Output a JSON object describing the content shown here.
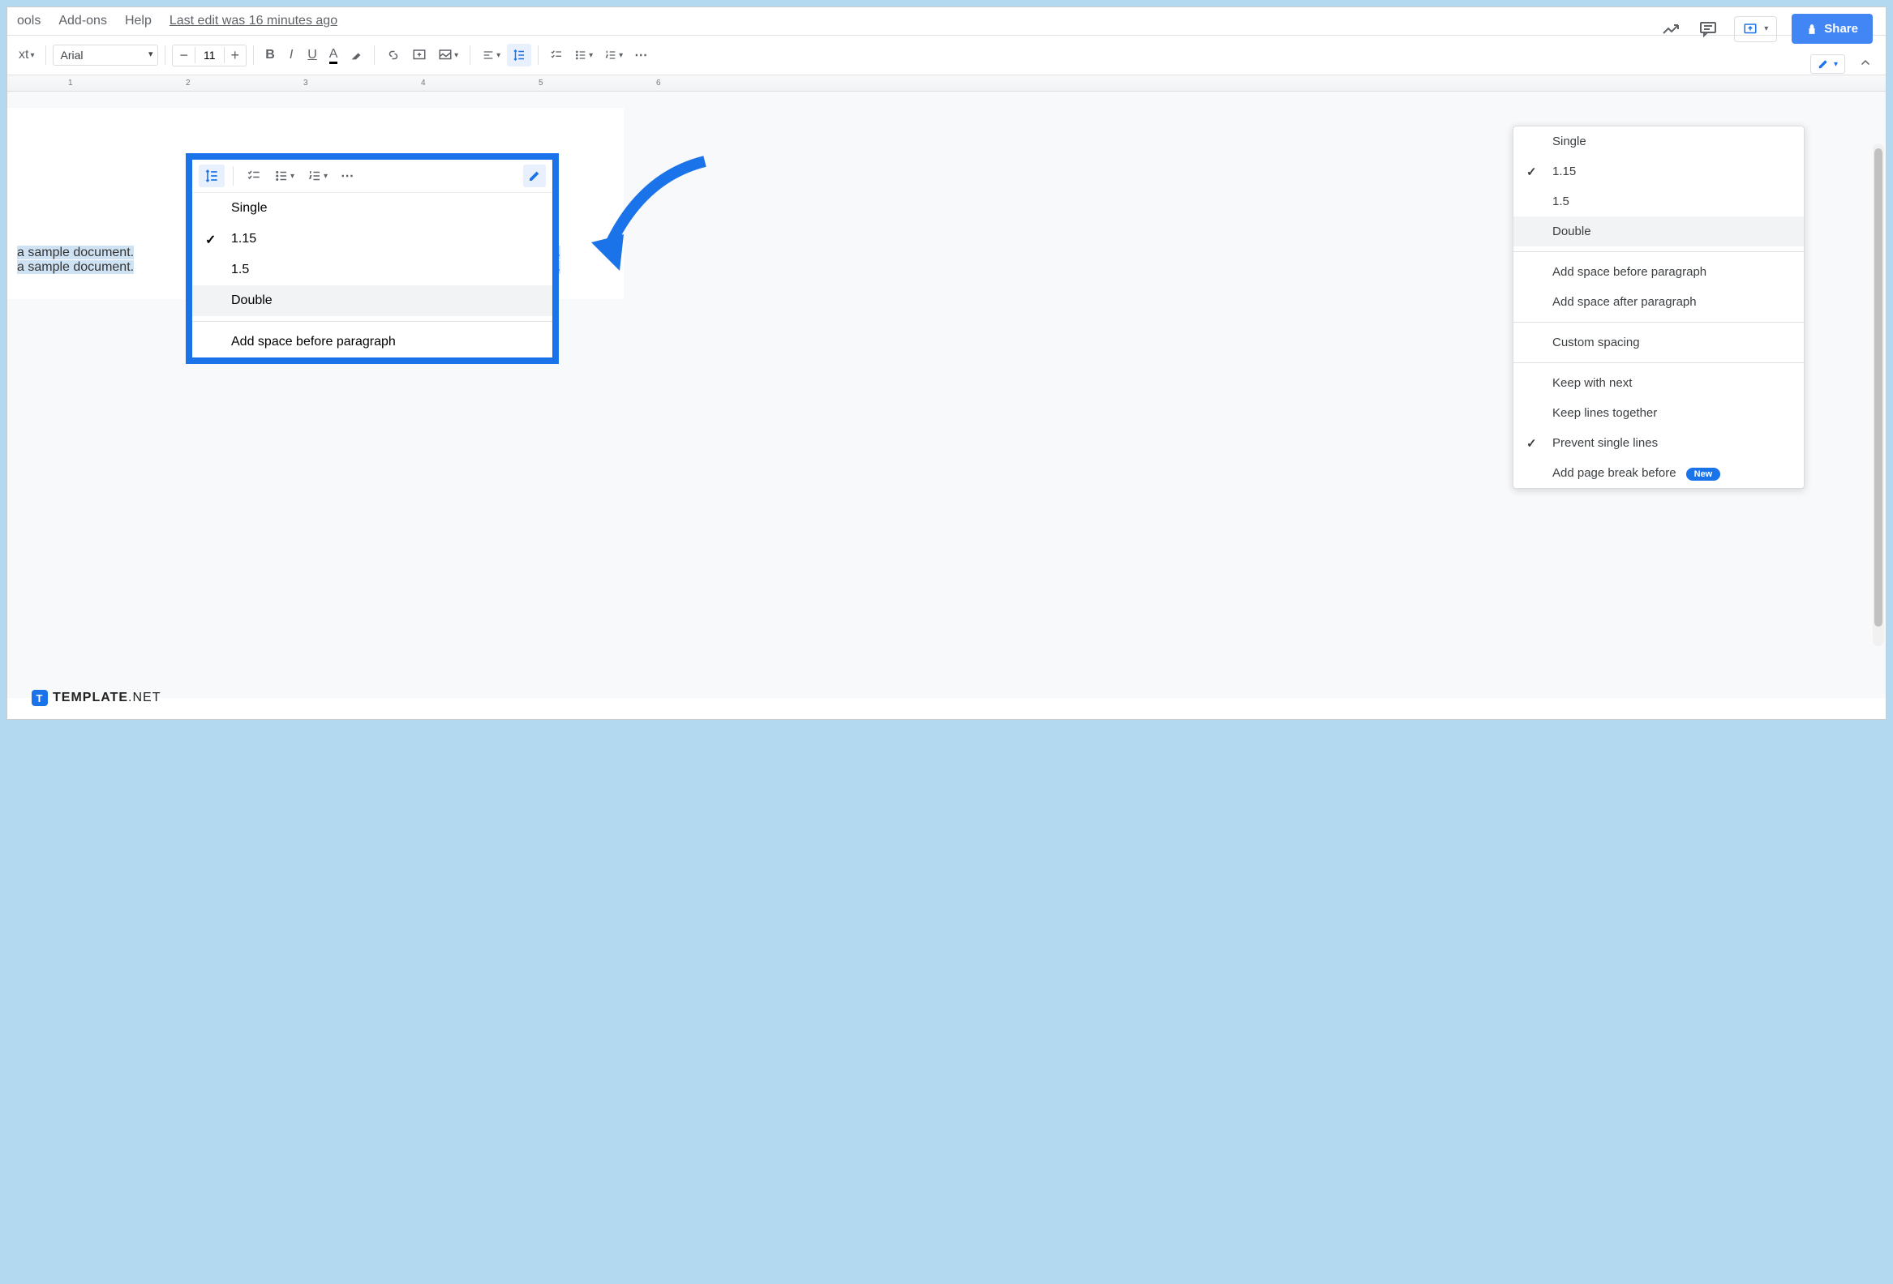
{
  "menubar": {
    "items": [
      "ools",
      "Add-ons",
      "Help"
    ],
    "last_edit": "Last edit was 16 minutes ago"
  },
  "share_label": "Share",
  "toolbar": {
    "styles_label": "xt",
    "font_name": "Arial",
    "font_size": "11"
  },
  "ruler_marks": [
    "1",
    "2",
    "3",
    "4",
    "5",
    "6"
  ],
  "doc_text": {
    "line1": "a sample document.",
    "line2": "a sample document.",
    "line1b": "cument.",
    "line2b": "cument."
  },
  "spacing_menu": {
    "single": "Single",
    "v115": "1.15",
    "v15": "1.5",
    "double": "Double",
    "add_before": "Add space before paragraph",
    "add_after": "Add space after paragraph",
    "custom": "Custom spacing",
    "keep_next": "Keep with next",
    "keep_lines": "Keep lines together",
    "prevent": "Prevent single lines",
    "page_break": "Add page break before",
    "new_badge": "New"
  },
  "callout_menu": {
    "single": "Single",
    "v115": "1.15",
    "v15": "1.5",
    "double": "Double",
    "add_before": "Add space before paragraph"
  },
  "footer": {
    "brand_bold": "TEMPLATE",
    "brand_light": ".NET"
  }
}
